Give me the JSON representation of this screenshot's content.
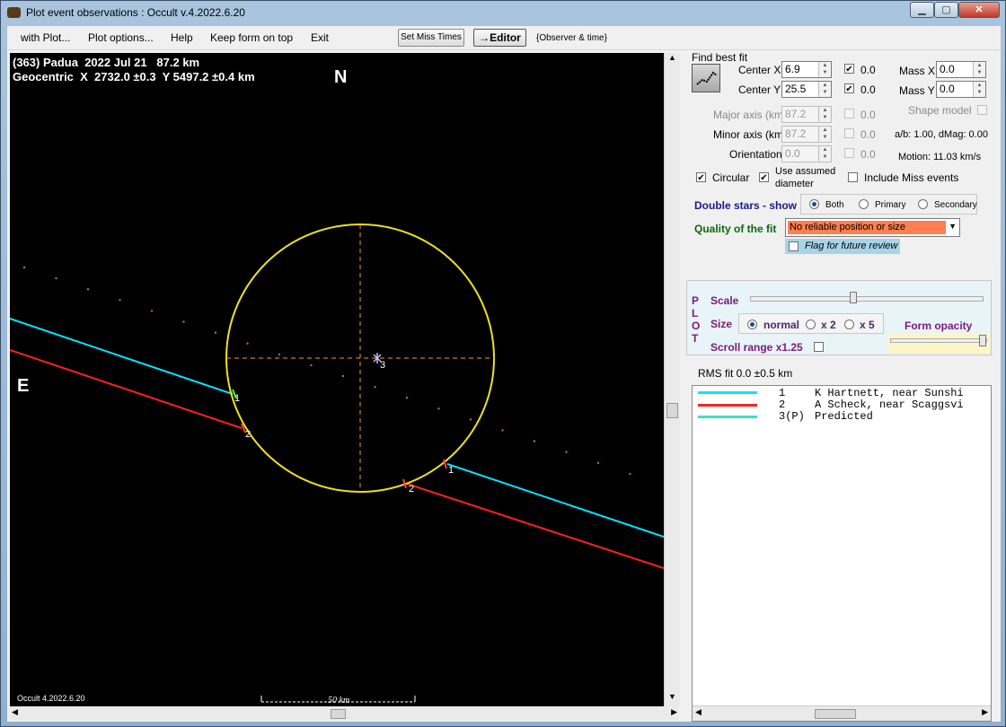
{
  "window": {
    "title": "Plot event observations : Occult v.4.2022.6.20"
  },
  "menu": {
    "with_plot": "with Plot...",
    "plot_options": "Plot options...",
    "help": "Help",
    "keep_on_top": "Keep form on top",
    "exit": "Exit",
    "set_miss_times": "Set Miss Times",
    "editor": "→Editor",
    "observer_time": "{Observer & time}"
  },
  "plot": {
    "header1": "(363) Padua  2022 Jul 21   87.2 km",
    "header2": "Geocentric  X  2732.0 ±0.3  Y 5497.2 ±0.4 km",
    "north": "N",
    "east": "E",
    "version": "Occult 4.2022.6.20",
    "scale_label": "50 km",
    "chord_labels": [
      "1",
      "2",
      "1",
      "2"
    ],
    "center_label": "3"
  },
  "colors": {
    "chord1": "#00e8ff",
    "chord2": "#ff2020",
    "predicted": "#40e0c0",
    "ellipse": "#f0e020",
    "path_dots": "#c06080"
  },
  "fit": {
    "find_best_fit": "Find best fit",
    "center_x_label": "Center X",
    "center_x": "6.9",
    "center_x_chk": "0.0",
    "center_y_label": "Center Y",
    "center_y": "25.5",
    "center_y_chk": "0.0",
    "mass_x_label": "Mass X",
    "mass_x": "0.0",
    "mass_y_label": "Mass Y",
    "mass_y": "0.0",
    "major_label": "Major axis (km)",
    "major": "87.2",
    "major_chk": "0.0",
    "minor_label": "Minor axis (km)",
    "minor": "87.2",
    "minor_chk": "0.0",
    "orient_label": "Orientation",
    "orient": "0.0",
    "orient_chk": "0.0",
    "shape_model": "Shape model",
    "ab": "a/b: 1.00, dMag: 0.00",
    "motion": "Motion: 11.03 km/s",
    "circular": "Circular",
    "use_assumed": "Use assumed",
    "diameter": "diameter",
    "include_miss": "Include Miss events"
  },
  "double": {
    "label": "Double stars - show",
    "both": "Both",
    "primary": "Primary",
    "secondary": "Secondary"
  },
  "quality": {
    "label": "Quality of the fit",
    "value": "No reliable position or size",
    "flag": "Flag for future review"
  },
  "plotbox": {
    "letters": [
      "P",
      "L",
      "O",
      "T"
    ],
    "scale": "Scale",
    "size": "Size",
    "normal": "normal",
    "x2": "x 2",
    "x5": "x 5",
    "opacity": "Form opacity",
    "scroll": "Scroll range x1.25"
  },
  "rms": "RMS fit 0.0 ±0.5 km",
  "legend": [
    {
      "num": "1",
      "name": "K Hartnett, near Sunshi"
    },
    {
      "num": "2",
      "name": "A Scheck, near Scaggsvi"
    },
    {
      "num": "3(P)",
      "name": "Predicted"
    }
  ]
}
